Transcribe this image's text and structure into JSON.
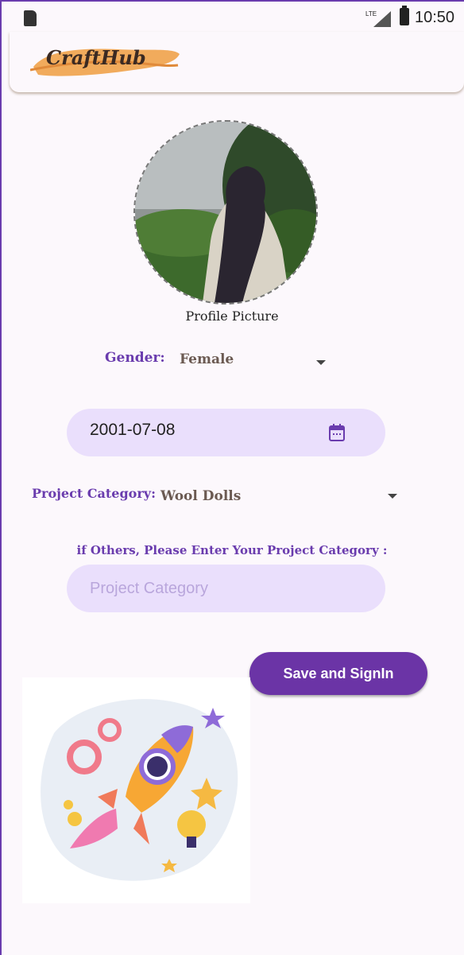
{
  "status_bar": {
    "network": "LTE",
    "time": "10:50"
  },
  "app_bar": {
    "logo_text": "CraftHub"
  },
  "profile": {
    "label": "Profile Picture"
  },
  "gender": {
    "label": "Gender:",
    "selected": "Female"
  },
  "birth_date": {
    "value": "2001-07-08"
  },
  "project_category": {
    "label": "Project Category:",
    "selected": "Wool Dolls"
  },
  "other_category": {
    "prompt": "if Others, Please Enter Your Project Category :",
    "placeholder": "Project Category"
  },
  "actions": {
    "save_label": "Save and SignIn"
  },
  "colors": {
    "accent": "#6a3cae",
    "field_bg": "#eadffc",
    "button_bg": "#6b34a6"
  }
}
